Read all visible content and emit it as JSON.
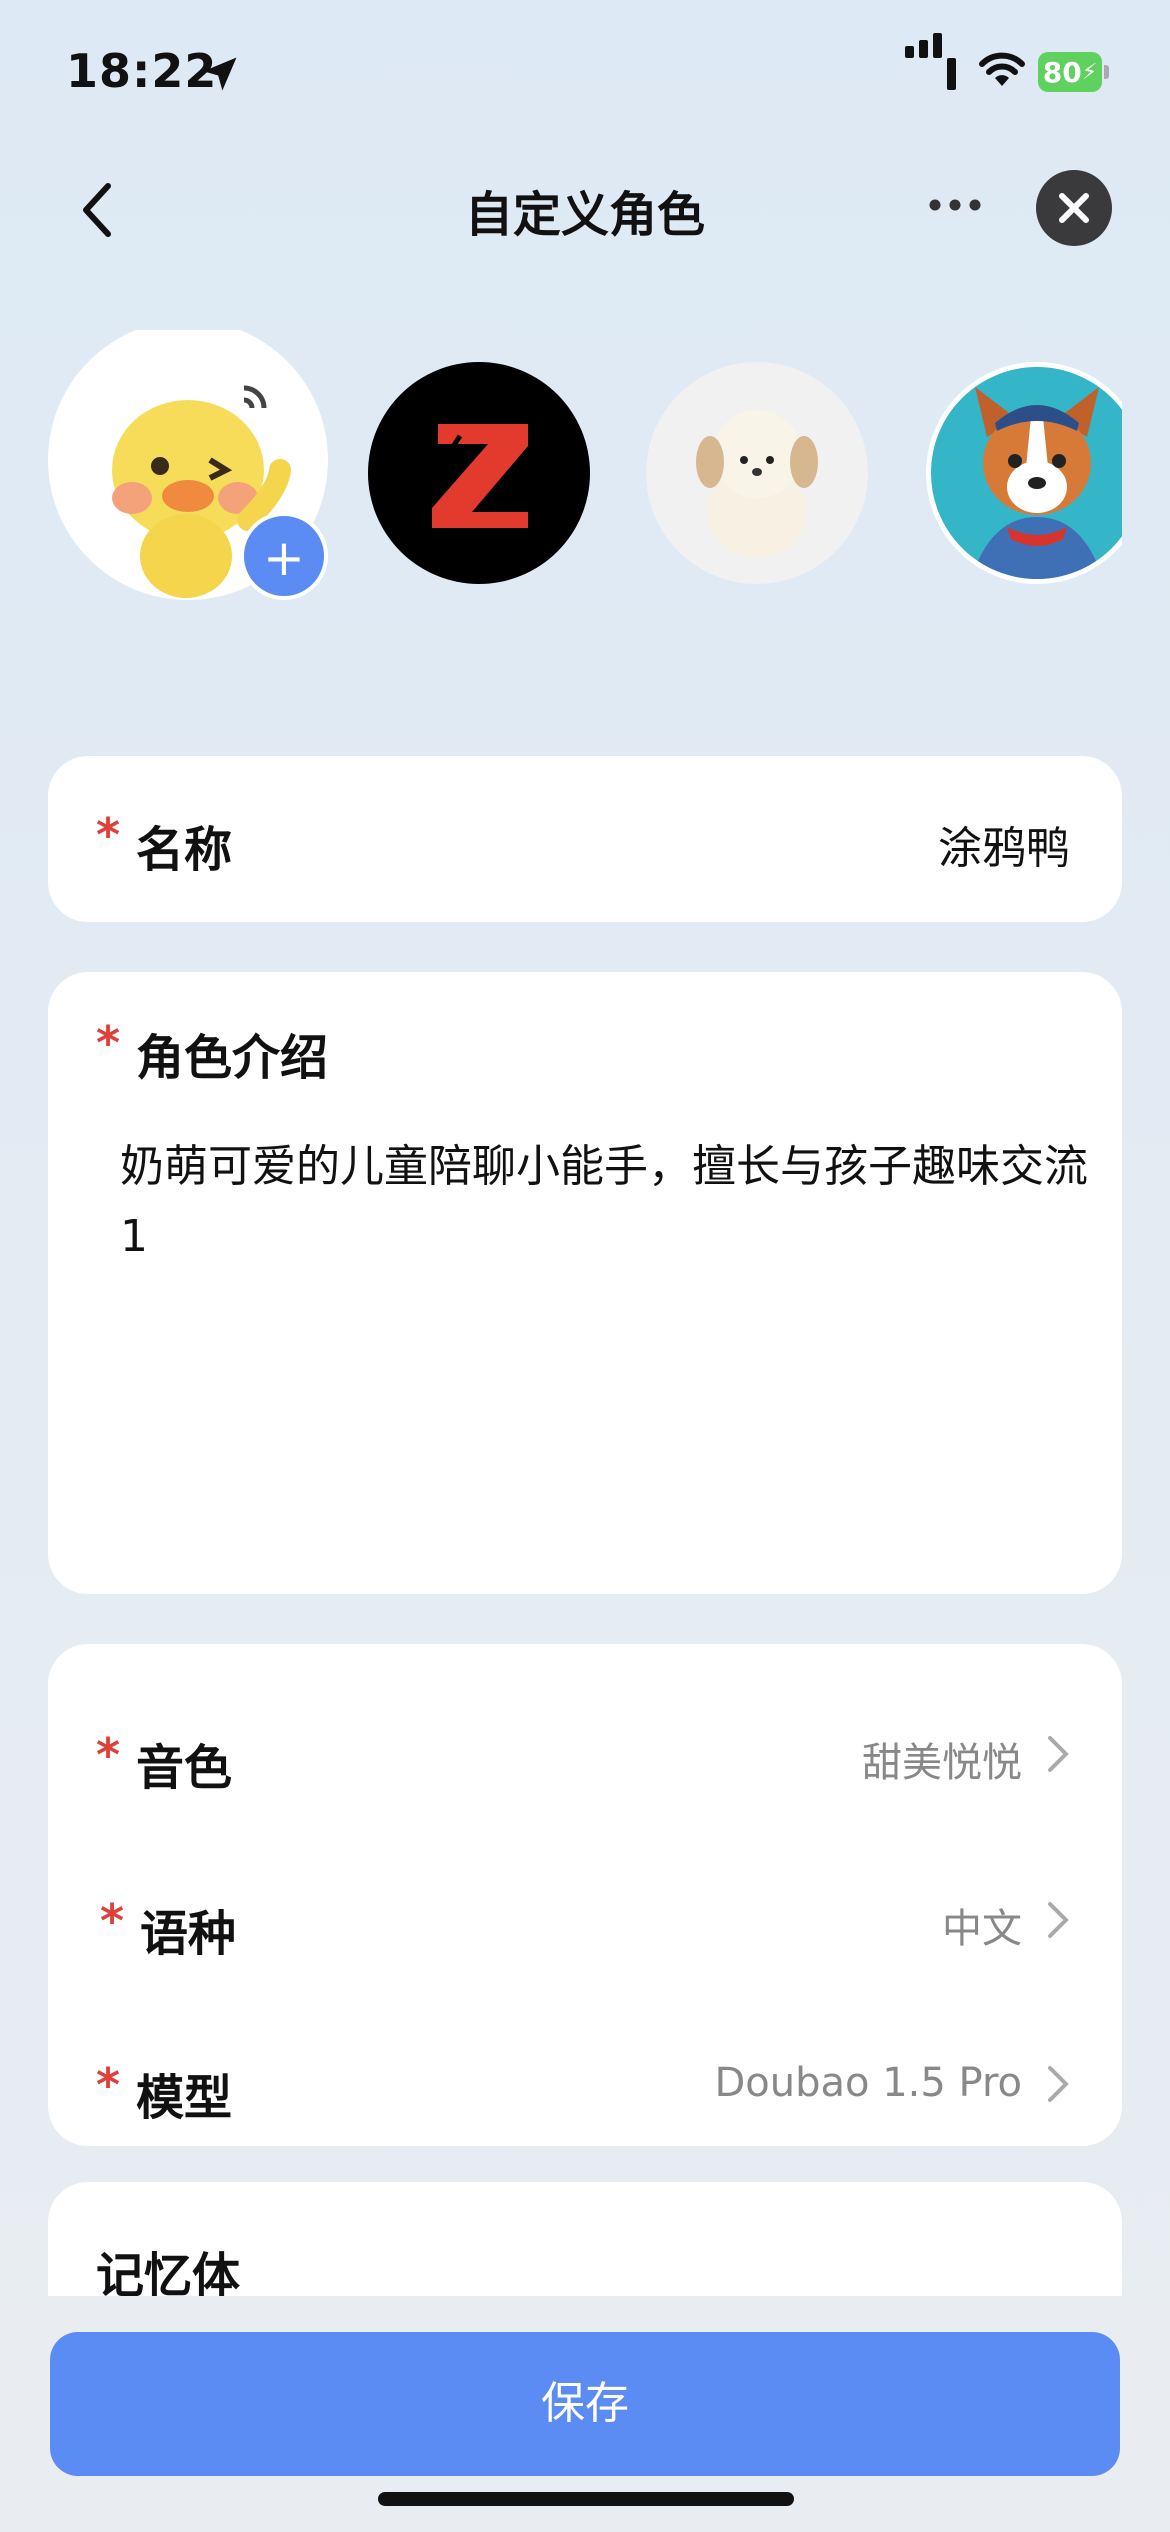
{
  "status": {
    "time": "18:22",
    "battery": "80"
  },
  "header": {
    "title": "自定义角色"
  },
  "avatars": [
    {
      "name": "duck-avatar",
      "selected": true
    },
    {
      "name": "z-logo-avatar",
      "letter": "Z"
    },
    {
      "name": "plush-dog-avatar"
    },
    {
      "name": "cartoon-dog-avatar"
    }
  ],
  "add_symbol": "+",
  "form": {
    "name": {
      "required_mark": "*",
      "label": "名称",
      "value": "涂鸦鸭"
    },
    "intro": {
      "required_mark": "*",
      "label": "角色介绍",
      "value": "奶萌可爱的儿童陪聊小能手，擅长与孩子趣味交流1"
    },
    "voice": {
      "required_mark": "*",
      "label": "音色",
      "value": "甜美悦悦"
    },
    "language": {
      "required_mark": "*",
      "label": "语种",
      "value": "中文"
    },
    "model": {
      "required_mark": "*",
      "label": "模型",
      "value": "Doubao 1.5 Pro"
    },
    "memory": {
      "label": "记忆体"
    }
  },
  "save_label": "保存",
  "colors": {
    "accent": "#5a8cf3",
    "required": "#e0403a"
  }
}
